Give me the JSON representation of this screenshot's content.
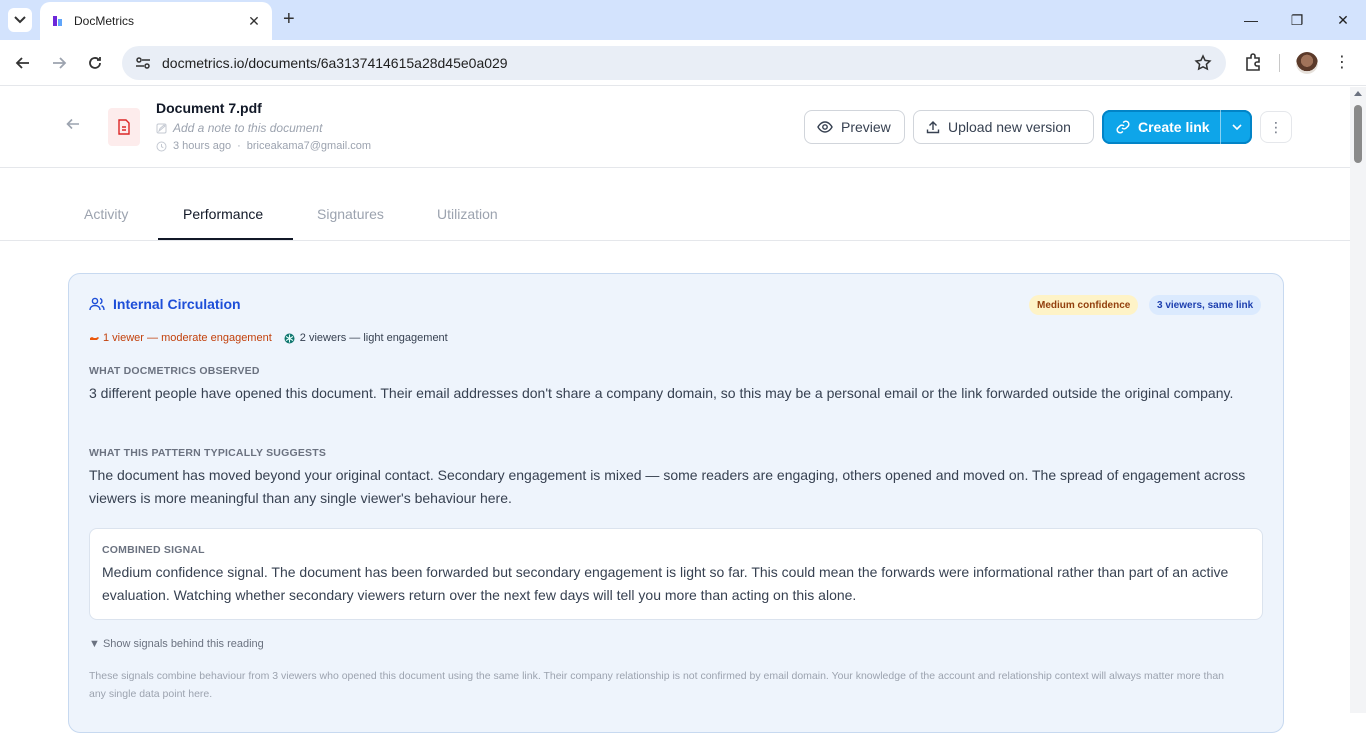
{
  "browser": {
    "tab_title": "DocMetrics",
    "url": "docmetrics.io/documents/6a3137414615a28d45e0a029"
  },
  "header": {
    "doc_title": "Document 7.pdf",
    "note_placeholder": "Add a note to this document",
    "time_ago": "3 hours ago",
    "owner_email": "briceakama7@gmail.com",
    "preview_label": "Preview",
    "upload_label": "Upload new version",
    "create_link_label": "Create link"
  },
  "tabs": [
    {
      "label": "Activity"
    },
    {
      "label": "Performance"
    },
    {
      "label": "Signatures"
    },
    {
      "label": "Utilization"
    }
  ],
  "card": {
    "title": "Internal Circulation",
    "badge_confidence": "Medium confidence",
    "badge_viewers": "3 viewers, same link",
    "engage_moderate": "1 viewer — moderate engagement",
    "engage_light": "2 viewers — light engagement",
    "observed_label": "WHAT DOCMETRICS OBSERVED",
    "observed_text": "3 different people have opened this document. Their email addresses don't share a company domain, so this may be a personal email or the link forwarded outside the original company.",
    "suggests_label": "WHAT THIS PATTERN TYPICALLY SUGGESTS",
    "suggests_text": "The document has moved beyond your original contact. Secondary engagement is mixed — some readers are engaging, others opened and moved on. The spread of engagement across viewers is more meaningful than any single viewer's behaviour here.",
    "combined_label": "COMBINED SIGNAL",
    "combined_text": "Medium confidence signal. The document has been forwarded but secondary engagement is light so far. This could mean the forwards were informational rather than part of an active evaluation. Watching whether secondary viewers return over the next few days will tell you more than acting on this alone.",
    "toggle_label": "▼ Show signals behind this reading",
    "footnote": "These signals combine behaviour from 3 viewers who opened this document using the same link. Their company relationship is not confirmed by email domain. Your knowledge of the account and relationship context will always matter more than any single data point here."
  },
  "colors": {
    "accent": "#0ea5e9",
    "card_title": "#1d4ed8",
    "card_bg": "#eef4fc"
  }
}
